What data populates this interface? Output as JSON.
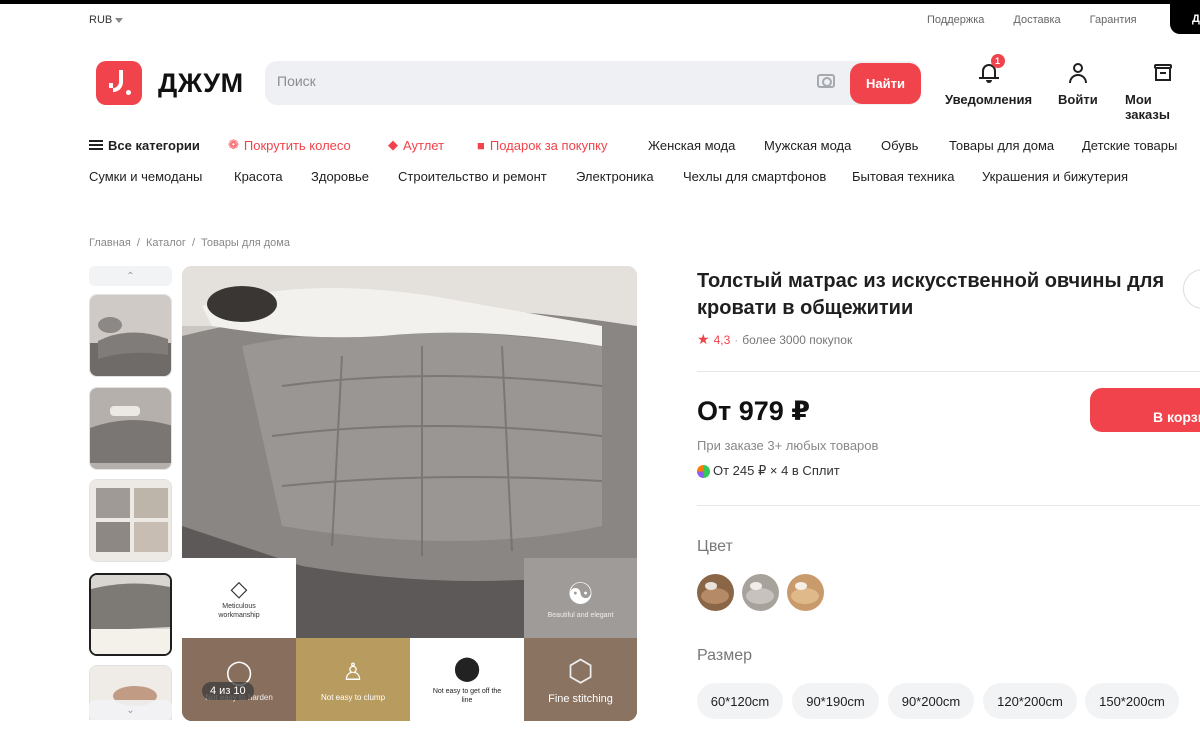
{
  "topbar": {
    "currency": "RUB",
    "links": [
      "Поддержка",
      "Доставка",
      "Гарантия"
    ],
    "corner_text": "Д"
  },
  "header": {
    "logo_text": "ДЖУМ",
    "search_placeholder": "Поиск",
    "search_button": "Найти",
    "notifications_label": "Уведомления",
    "notifications_count": "1",
    "login_label": "Войти",
    "orders_label": "Мои заказы"
  },
  "nav": {
    "row1": [
      {
        "label": "Все категории",
        "icon": "menu-icon"
      },
      {
        "label": "Покрутить колесо",
        "icon": "wheel-icon"
      },
      {
        "label": "Аутлет",
        "icon": "tag-icon"
      },
      {
        "label": "Подарок за покупку",
        "icon": "gift-icon"
      },
      {
        "label": "Женская мода"
      },
      {
        "label": "Мужская мода"
      },
      {
        "label": "Обувь"
      },
      {
        "label": "Товары для дома"
      },
      {
        "label": "Детские товары"
      }
    ],
    "row2": [
      "Сумки и чемоданы",
      "Красота",
      "Здоровье",
      "Строительство и ремонт",
      "Электроника",
      "Чехлы для смартфонов",
      "Бытовая техника",
      "Украшения и бижутерия"
    ]
  },
  "breadcrumb": [
    "Главная",
    "Каталог",
    "Товары для дома"
  ],
  "gallery": {
    "counter": "4 из 10",
    "features": [
      {
        "label": "Meticulous workmanship",
        "icon": "diamond-icon"
      },
      {
        "label": "Beautiful and elegant",
        "icon": "swirl-icon"
      },
      {
        "label": "Not easy to harden",
        "icon": "molecule-icon"
      },
      {
        "label": "Not easy to clump",
        "icon": "person-icon"
      },
      {
        "label": "Not easy to get off the line",
        "icon": "yarn-icon"
      },
      {
        "label": "Fine stitching",
        "icon": "hexagon-icon"
      }
    ]
  },
  "product": {
    "title": "Толстый матрас из искусственной овчины для кровати в общежитии",
    "rating": "4,3",
    "sales": "более 3000 покупок",
    "price": "От 979 ₽",
    "price_note": "При заказе 3+ любых товаров",
    "split": "От 245 ₽ × 4 в Сплит",
    "cart_button": "В корзину",
    "color_label": "Цвет",
    "colors": [
      "#8a6546",
      "#a8a29d",
      "#c99a6b"
    ],
    "size_label": "Размер",
    "sizes": [
      "60*120cm",
      "90*190cm",
      "90*200cm",
      "120*200cm",
      "150*200cm"
    ]
  }
}
